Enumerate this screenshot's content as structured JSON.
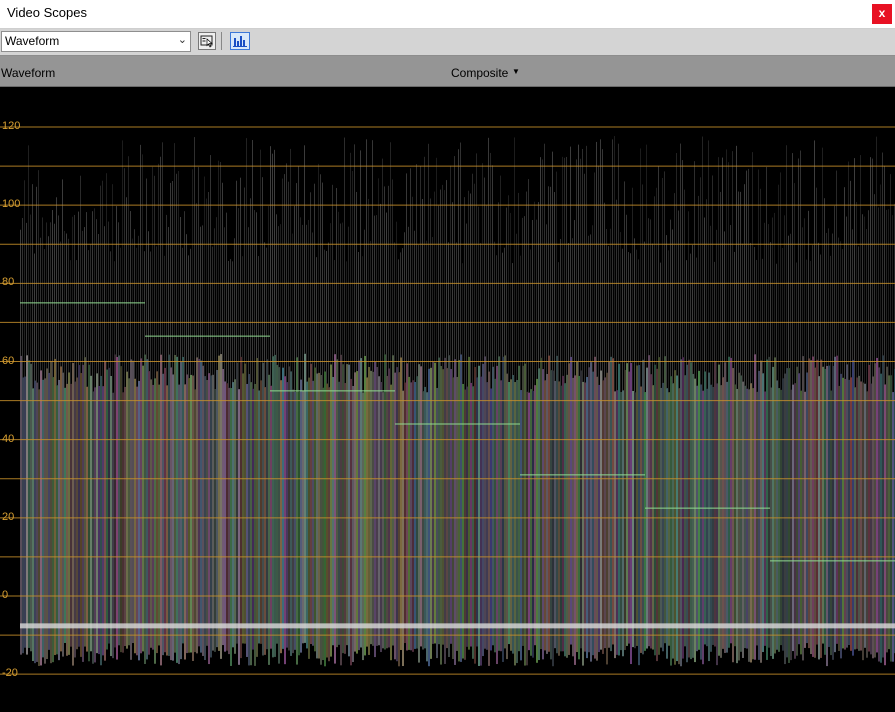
{
  "window": {
    "title": "Video Scopes",
    "close_label": "x"
  },
  "toolbar": {
    "scope_select": {
      "value": "Waveform"
    },
    "buttons": [
      {
        "name": "settings-icon",
        "pressed": false
      },
      {
        "name": "update-scopes-icon",
        "pressed": true
      }
    ]
  },
  "header": {
    "label": "Waveform",
    "mode": "Composite"
  },
  "scope": {
    "y_axis": {
      "ticks": [
        "120",
        "100",
        "80",
        "60",
        "40",
        "20",
        "0",
        "-20"
      ],
      "min": -20,
      "max": 120,
      "gridline_step": 10
    },
    "colors": {
      "gridline": "#c8912b",
      "tick_label": "#d8a032",
      "trace": "#8fd98f",
      "background": "#000000"
    },
    "color_bar_levels": [
      75,
      66.5,
      52.5,
      44,
      31,
      22.5,
      9
    ]
  }
}
